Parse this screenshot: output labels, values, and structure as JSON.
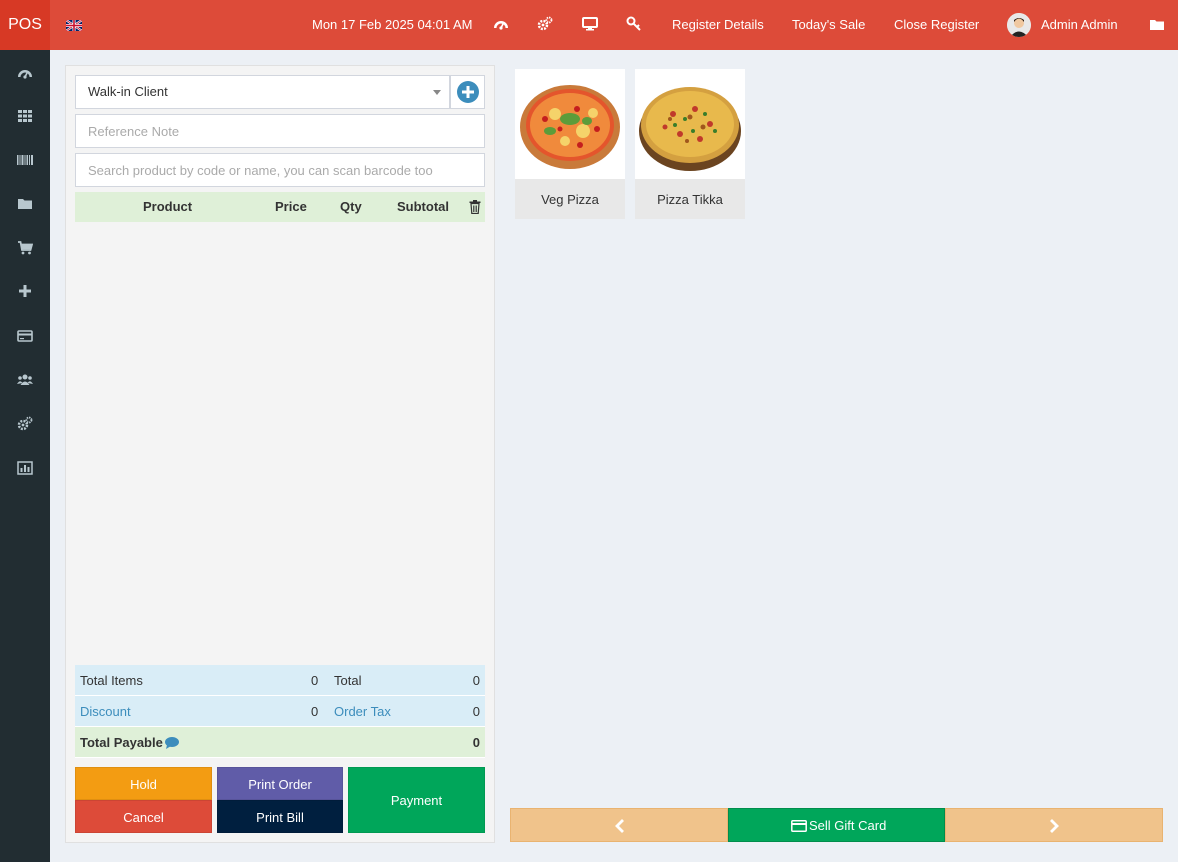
{
  "header": {
    "logo": "POS",
    "datetime": "Mon 17 Feb 2025 04:01 AM",
    "links": {
      "register_details": "Register Details",
      "todays_sale": "Today's Sale",
      "close_register": "Close Register"
    },
    "user_name": "Admin Admin",
    "brand_color": "#dd4b39"
  },
  "sidebar": {
    "icons": [
      "dashboard-icon",
      "grid-icon",
      "barcode-icon",
      "folder-icon",
      "cart-icon",
      "plus-icon",
      "credit-card-icon",
      "users-icon",
      "cogs-icon",
      "bar-chart-icon"
    ]
  },
  "sale": {
    "client": "Walk-in Client",
    "reference_placeholder": "Reference Note",
    "search_placeholder": "Search product by code or name, you can scan barcode too",
    "columns": {
      "product": "Product",
      "price": "Price",
      "qty": "Qty",
      "subtotal": "Subtotal"
    },
    "totals": {
      "total_items_label": "Total Items",
      "total_items_value": "0",
      "total_label": "Total",
      "total_value": "0",
      "discount_label": "Discount",
      "discount_value": "0",
      "order_tax_label": "Order Tax",
      "order_tax_value": "0",
      "total_payable_label": "Total Payable",
      "total_payable_value": "0"
    },
    "buttons": {
      "hold": "Hold",
      "cancel": "Cancel",
      "print_order": "Print Order",
      "print_bill": "Print Bill",
      "payment": "Payment"
    }
  },
  "products": [
    {
      "name": "Veg Pizza"
    },
    {
      "name": "Pizza Tikka"
    }
  ],
  "bottom_nav": {
    "sell_gift_card": "Sell Gift Card"
  }
}
